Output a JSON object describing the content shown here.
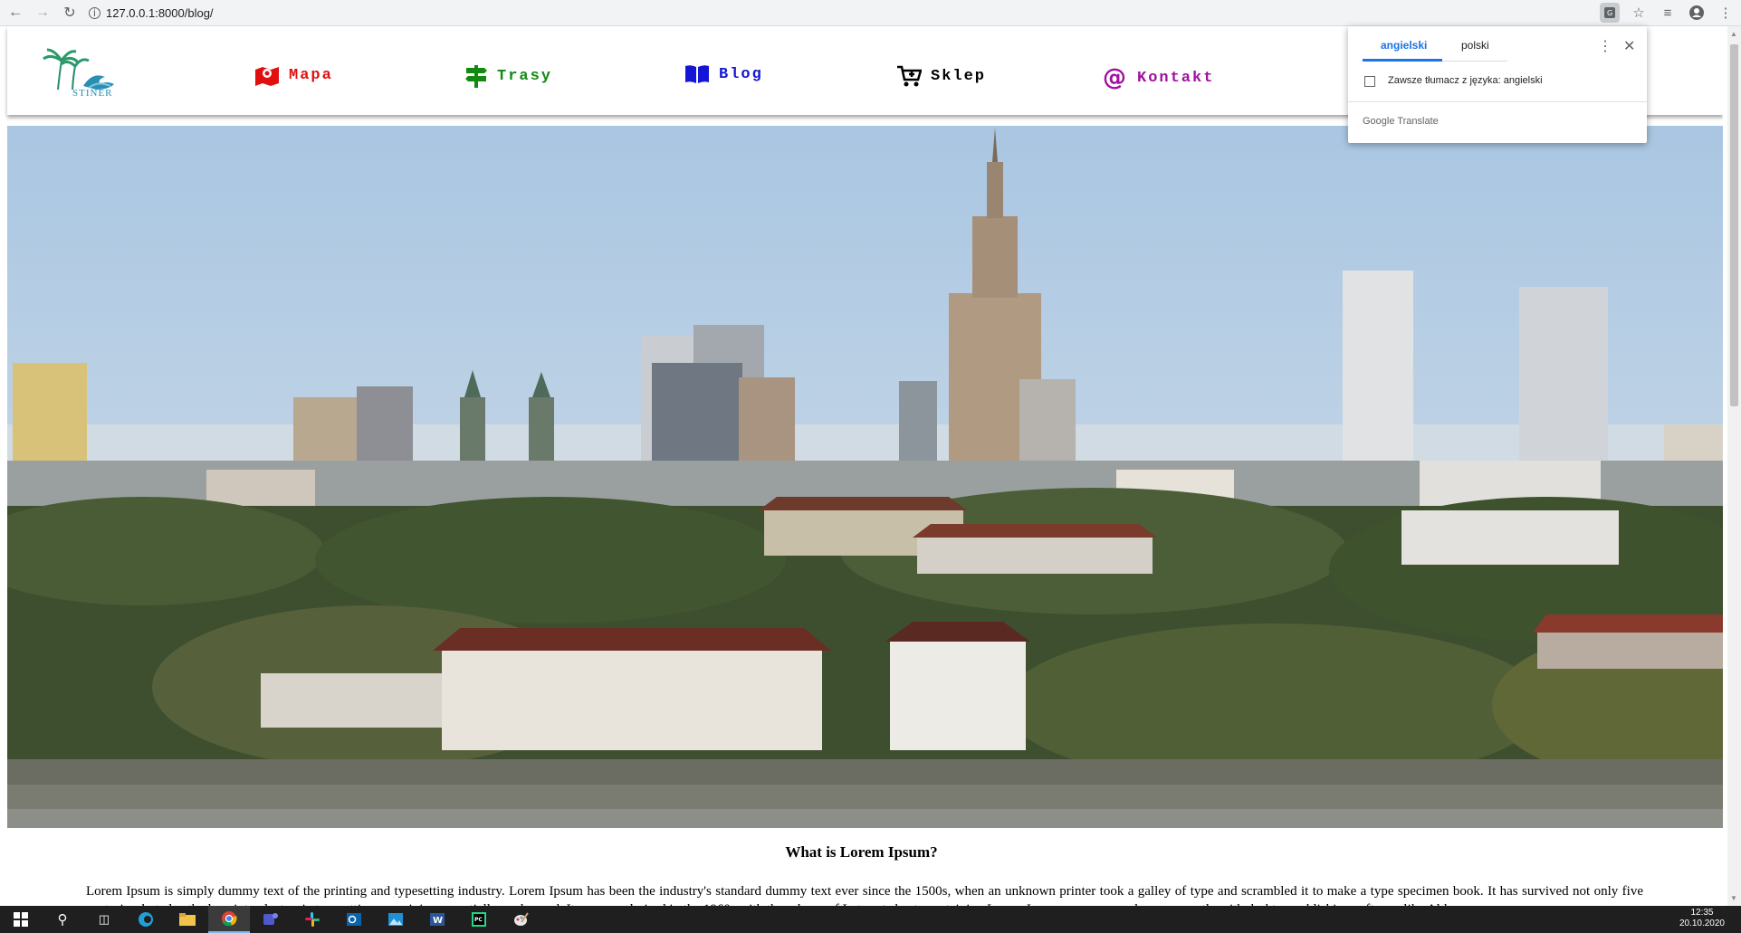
{
  "browser": {
    "url": "127.0.0.1:8000/blog/",
    "back_icon": "arrow-left-icon",
    "forward_icon": "arrow-right-icon",
    "reload_icon": "reload-icon"
  },
  "site": {
    "logo_text": "STINER",
    "nav": [
      {
        "label": "Mapa",
        "icon": "map-marker-icon",
        "color": "#e01010"
      },
      {
        "label": "Trasy",
        "icon": "signpost-icon",
        "color": "#128a12"
      },
      {
        "label": "Blog",
        "icon": "book-icon",
        "color": "#1515d8"
      },
      {
        "label": "Sklep",
        "icon": "cart-icon",
        "color": "#000000"
      },
      {
        "label": "Kontakt",
        "icon": "at-icon",
        "color": "#a010a0"
      }
    ]
  },
  "article": {
    "title": "What is Lorem Ipsum?",
    "body": "Lorem Ipsum is simply dummy text of the printing and typesetting industry. Lorem Ipsum has been the industry's standard dummy text ever since the 1500s, when an unknown printer took a galley of type and scrambled it to make a type specimen book. It has survived not only five centuries, but also the leap into electronic typesetting, remaining essentially unchanged. It was popularised in the 1960s with the release of Letraset sheets containing Lorem Ipsum passages, and more recently with desktop publishing software like Aldus"
  },
  "translate_popup": {
    "tab_source": "angielski",
    "tab_target": "polski",
    "always_translate": "Zawsze tłumacz z języka: angielski",
    "footer": "Google Translate"
  },
  "taskbar": {
    "time": "12:35",
    "date": "20.10.2020"
  }
}
